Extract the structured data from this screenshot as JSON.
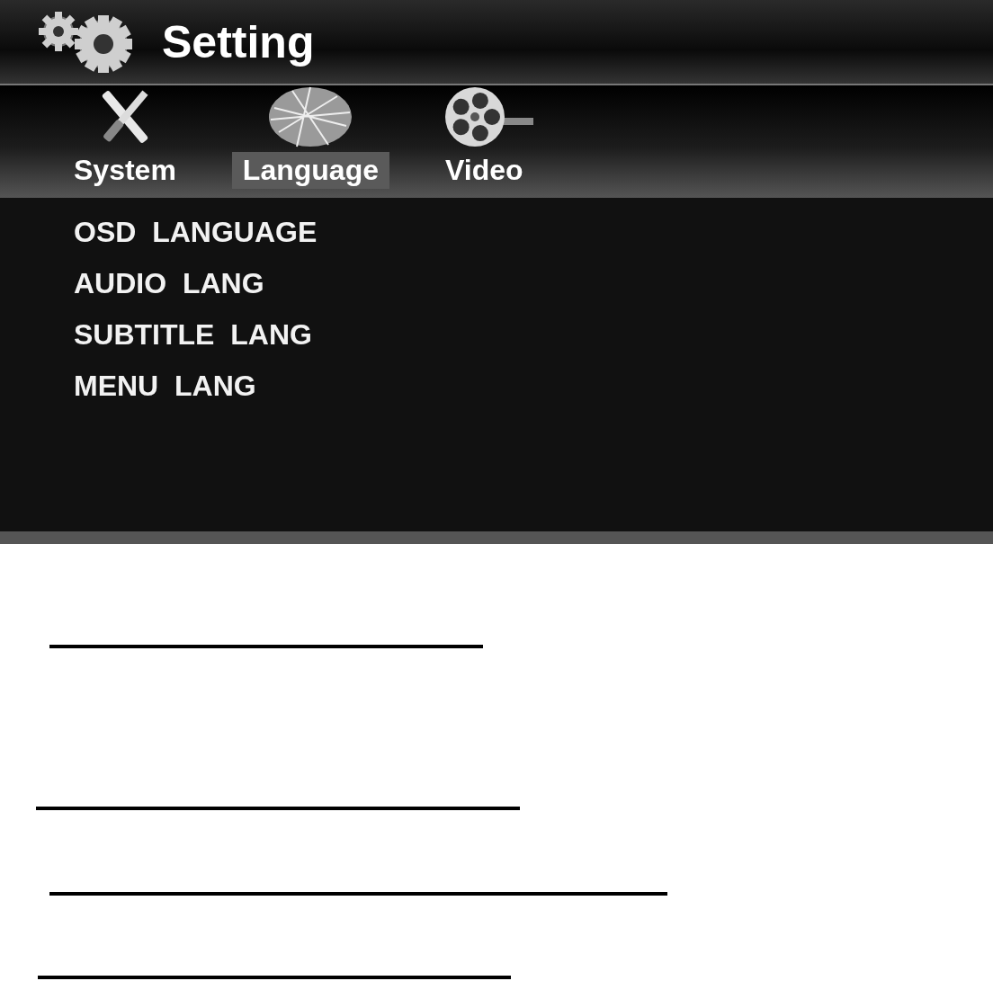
{
  "window": {
    "title": "Setting"
  },
  "tabs": [
    {
      "label": "System",
      "kind": "tools",
      "selected": false
    },
    {
      "label": "Language",
      "kind": "globe",
      "selected": true
    },
    {
      "label": "Video",
      "kind": "reel",
      "selected": false
    }
  ],
  "menu": [
    {
      "label": "OSD  LANGUAGE"
    },
    {
      "label": "AUDIO  LANG"
    },
    {
      "label": "SUBTITLE  LANG"
    },
    {
      "label": "MENU  LANG"
    }
  ]
}
